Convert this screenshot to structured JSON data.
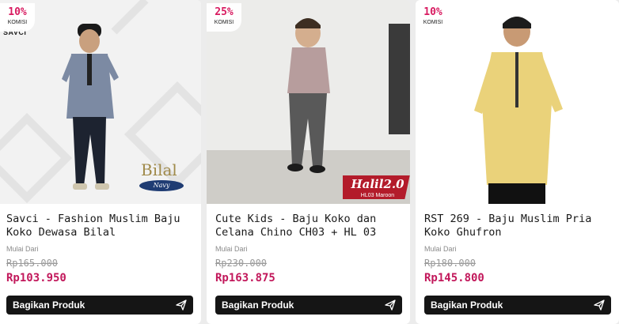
{
  "products": [
    {
      "commission": "10%",
      "commission_label": "KOMISI",
      "brand_logo": "SAVCI",
      "image_text": "Bilal",
      "image_subtext": "Navy",
      "title": "Savci - Fashion Muslim Baju Koko Dewasa Bilal",
      "from_label": "Mulai Dari",
      "old_price": "Rp165.000",
      "price": "Rp103.950",
      "share_label": "Bagikan Produk",
      "share_icon": "send-icon"
    },
    {
      "commission": "25%",
      "commission_label": "KOMISI",
      "image_text": "Halil2.0",
      "image_subtext": "HL03 Maroon",
      "title": "Cute Kids - Baju Koko dan Celana Chino CH03 + HL 03",
      "from_label": "Mulai Dari",
      "old_price": "Rp230.000",
      "price": "Rp163.875",
      "share_label": "Bagikan Produk",
      "share_icon": "send-icon"
    },
    {
      "commission": "10%",
      "commission_label": "KOMISI",
      "title": "RST 269 - Baju Muslim Pria Koko Ghufron",
      "from_label": "Mulai Dari",
      "old_price": "Rp180.000",
      "price": "Rp145.800",
      "share_label": "Bagikan Produk",
      "share_icon": "send-icon"
    }
  ],
  "colors": {
    "commission": "#d81b60",
    "price": "#c2185b",
    "share_button": "#151515"
  }
}
